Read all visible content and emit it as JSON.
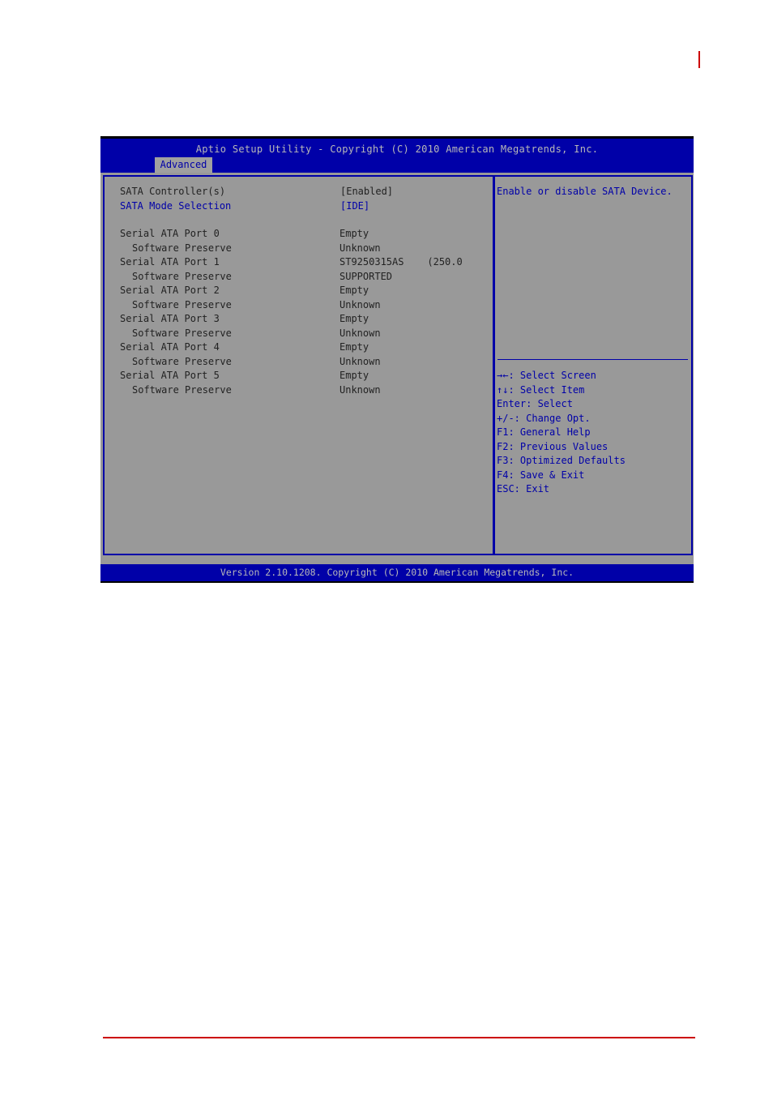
{
  "window": {
    "title": "Aptio Setup Utility - Copyright (C) 2010 American Megatrends, Inc.",
    "active_tab": "Advanced",
    "footer": "Version 2.10.1208. Copyright (C) 2010 American Megatrends, Inc."
  },
  "settings": [
    {
      "label": "SATA Controller(s)",
      "value": "[Enabled]",
      "indent": false,
      "highlighted": false
    },
    {
      "label": "SATA Mode Selection",
      "value": "[IDE]",
      "indent": false,
      "highlighted": true
    }
  ],
  "ports": [
    {
      "label": "Serial ATA Port 0",
      "value": "Empty"
    },
    {
      "label": "Software Preserve",
      "value": "Unknown"
    },
    {
      "label": "Serial ATA Port 1",
      "value": "ST9250315AS    (250.0"
    },
    {
      "label": "Software Preserve",
      "value": "SUPPORTED"
    },
    {
      "label": "Serial ATA Port 2",
      "value": "Empty"
    },
    {
      "label": "Software Preserve",
      "value": "Unknown"
    },
    {
      "label": "Serial ATA Port 3",
      "value": "Empty"
    },
    {
      "label": "Software Preserve",
      "value": "Unknown"
    },
    {
      "label": "Serial ATA Port 4",
      "value": "Empty"
    },
    {
      "label": "Software Preserve",
      "value": "Unknown"
    },
    {
      "label": "Serial ATA Port 5",
      "value": "Empty"
    },
    {
      "label": "Software Preserve",
      "value": "Unknown"
    }
  ],
  "help": {
    "description": "Enable or disable SATA Device.",
    "keys": [
      "→←: Select Screen",
      "↑↓: Select Item",
      "Enter: Select",
      "+/-: Change Opt.",
      "F1: General Help",
      "F2: Previous Values",
      "F3: Optimized Defaults",
      "F4: Save & Exit",
      "ESC: Exit"
    ]
  },
  "colors": {
    "bios_blue": "#0000a8",
    "bios_gray": "#999999",
    "accent_red": "#cc0000"
  }
}
